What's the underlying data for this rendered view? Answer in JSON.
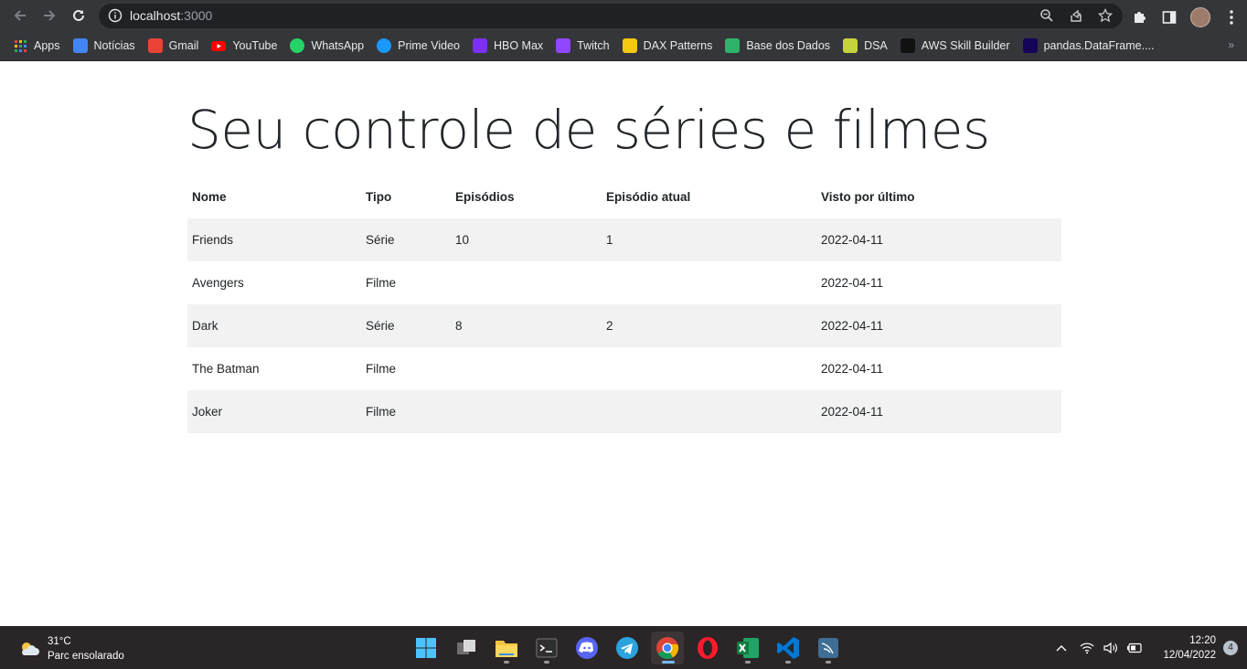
{
  "browser": {
    "url_host": "localhost",
    "url_port": ":3000"
  },
  "bookmarks": [
    {
      "label": "Apps",
      "icon": "apps-grid-icon",
      "color": "#e8eaed"
    },
    {
      "label": "Notícias",
      "icon": "news-icon",
      "color": "#4285f4"
    },
    {
      "label": "Gmail",
      "icon": "gmail-icon",
      "color": "#ea4335"
    },
    {
      "label": "YouTube",
      "icon": "youtube-icon",
      "color": "#ff0000"
    },
    {
      "label": "WhatsApp",
      "icon": "whatsapp-icon",
      "color": "#25d366"
    },
    {
      "label": "Prime Video",
      "icon": "prime-video-icon",
      "color": "#1a98ff"
    },
    {
      "label": "HBO Max",
      "icon": "hbo-max-icon",
      "color": "#7b2ff7"
    },
    {
      "label": "Twitch",
      "icon": "twitch-icon",
      "color": "#9146ff"
    },
    {
      "label": "DAX Patterns",
      "icon": "dax-patterns-icon",
      "color": "#f2c811"
    },
    {
      "label": "Base dos Dados",
      "icon": "base-dos-dados-icon",
      "color": "#2fb36a"
    },
    {
      "label": "DSA",
      "icon": "dsa-icon",
      "color": "#c7d33a"
    },
    {
      "label": "AWS Skill Builder",
      "icon": "aws-icon",
      "color": "#111111"
    },
    {
      "label": "pandas.DataFrame....",
      "icon": "pandas-icon",
      "color": "#150458"
    }
  ],
  "page": {
    "title": "Seu controle de séries e filmes",
    "columns": [
      "Nome",
      "Tipo",
      "Episódios",
      "Episódio atual",
      "Visto por último"
    ],
    "rows": [
      {
        "nome": "Friends",
        "tipo": "Série",
        "episodios": "10",
        "episodio_atual": "1",
        "visto": "2022-04-11"
      },
      {
        "nome": "Avengers",
        "tipo": "Filme",
        "episodios": "",
        "episodio_atual": "",
        "visto": "2022-04-11"
      },
      {
        "nome": "Dark",
        "tipo": "Série",
        "episodios": "8",
        "episodio_atual": "2",
        "visto": "2022-04-11"
      },
      {
        "nome": "The Batman",
        "tipo": "Filme",
        "episodios": "",
        "episodio_atual": "",
        "visto": "2022-04-11"
      },
      {
        "nome": "Joker",
        "tipo": "Filme",
        "episodios": "",
        "episodio_atual": "",
        "visto": "2022-04-11"
      }
    ]
  },
  "taskbar": {
    "weather_temp": "31°C",
    "weather_desc": "Parc ensolarado",
    "time": "12:20",
    "date": "12/04/2022",
    "notifications": "4",
    "apps": [
      "start-icon",
      "task-view-icon",
      "file-explorer-icon",
      "terminal-icon",
      "discord-icon",
      "telegram-icon",
      "chrome-icon",
      "opera-icon",
      "excel-icon",
      "vscode-icon",
      "mysql-workbench-icon"
    ]
  }
}
